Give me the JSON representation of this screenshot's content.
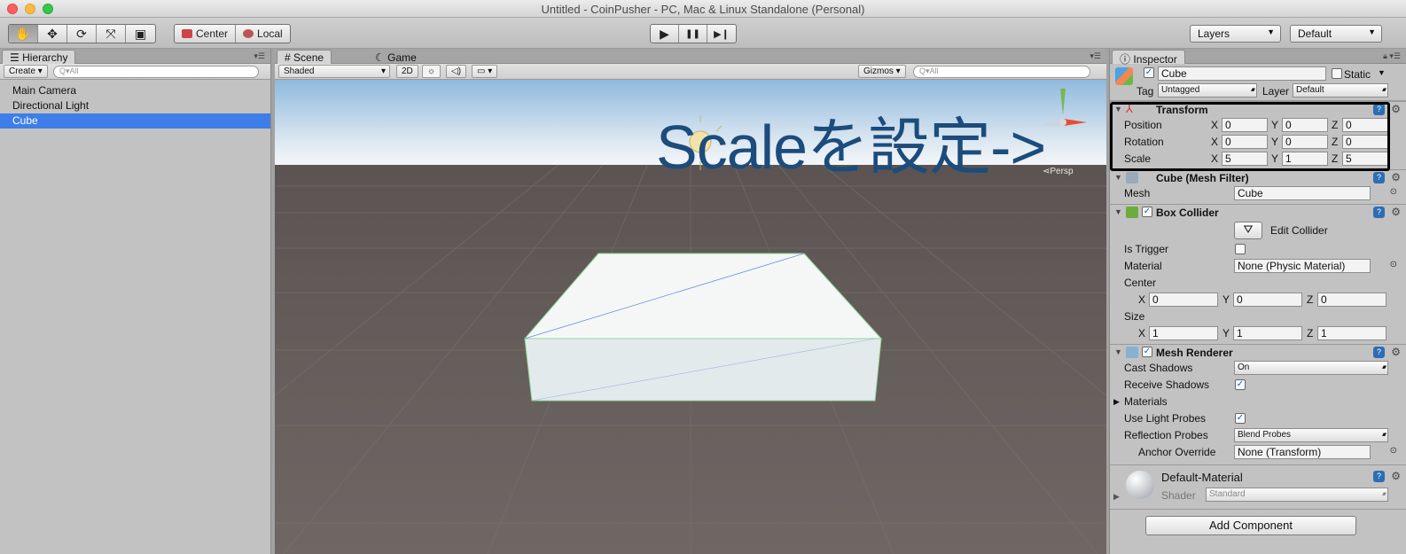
{
  "window": {
    "title": "Untitled - CoinPusher - PC, Mac & Linux Standalone (Personal)"
  },
  "toolbar": {
    "tools": [
      {
        "name": "hand-tool",
        "glyph": "✋"
      },
      {
        "name": "move-tool",
        "glyph": "✥"
      },
      {
        "name": "rotate-tool",
        "glyph": "⟳"
      },
      {
        "name": "scale-tool",
        "glyph": "⤧"
      },
      {
        "name": "rect-tool",
        "glyph": "▣"
      }
    ],
    "pivot_label": "Center",
    "space_label": "Local",
    "play_glyph": "▶",
    "pause_glyph": "❚❚",
    "step_glyph": "▶❙",
    "layers_label": "Layers",
    "layout_label": "Default"
  },
  "hierarchy": {
    "tab_label": "Hierarchy",
    "create_label": "Create",
    "search_placeholder": "Q▾All",
    "items": [
      "Main Camera",
      "Directional Light",
      "Cube"
    ],
    "selected_index": 2
  },
  "scene": {
    "tab_scene": "Scene",
    "tab_game": "Game",
    "shading_mode": "Shaded",
    "mode_2d": "2D",
    "gizmos_label": "Gizmos",
    "search_placeholder": "Q▾All",
    "persp_label": "Persp",
    "annotation": "Scaleを設定->",
    "colors": {
      "sky_top": "#9fc3e2",
      "horizon": "#f0f4f7",
      "ground": "#6e6663"
    }
  },
  "inspector": {
    "tab_label": "Inspector",
    "object_name": "Cube",
    "static_label": "Static",
    "tag_label": "Tag",
    "tag_value": "Untagged",
    "layer_label": "Layer",
    "layer_value": "Default",
    "transform": {
      "title": "Transform",
      "position_label": "Position",
      "rotation_label": "Rotation",
      "scale_label": "Scale",
      "position": {
        "x": "0",
        "y": "0",
        "z": "0"
      },
      "rotation": {
        "x": "0",
        "y": "0",
        "z": "0"
      },
      "scale": {
        "x": "5",
        "y": "1",
        "z": "5"
      }
    },
    "mesh_filter": {
      "title": "Cube (Mesh Filter)",
      "mesh_label": "Mesh",
      "mesh_value": "Cube"
    },
    "box_collider": {
      "title": "Box Collider",
      "edit_label": "Edit Collider",
      "is_trigger_label": "Is Trigger",
      "material_label": "Material",
      "material_value": "None (Physic Material)",
      "center_label": "Center",
      "size_label": "Size",
      "center": {
        "x": "0",
        "y": "0",
        "z": "0"
      },
      "size": {
        "x": "1",
        "y": "1",
        "z": "1"
      }
    },
    "mesh_renderer": {
      "title": "Mesh Renderer",
      "cast_shadows_label": "Cast Shadows",
      "cast_shadows_value": "On",
      "receive_shadows_label": "Receive Shadows",
      "materials_label": "Materials",
      "light_probes_label": "Use Light Probes",
      "reflection_probes_label": "Reflection Probes",
      "reflection_probes_value": "Blend Probes",
      "anchor_override_label": "Anchor Override",
      "anchor_override_value": "None (Transform)"
    },
    "material": {
      "name": "Default-Material",
      "shader_label": "Shader",
      "shader_value": "Standard"
    },
    "add_component_label": "Add Component",
    "axis_labels": {
      "x": "X",
      "y": "Y",
      "z": "Z"
    }
  }
}
